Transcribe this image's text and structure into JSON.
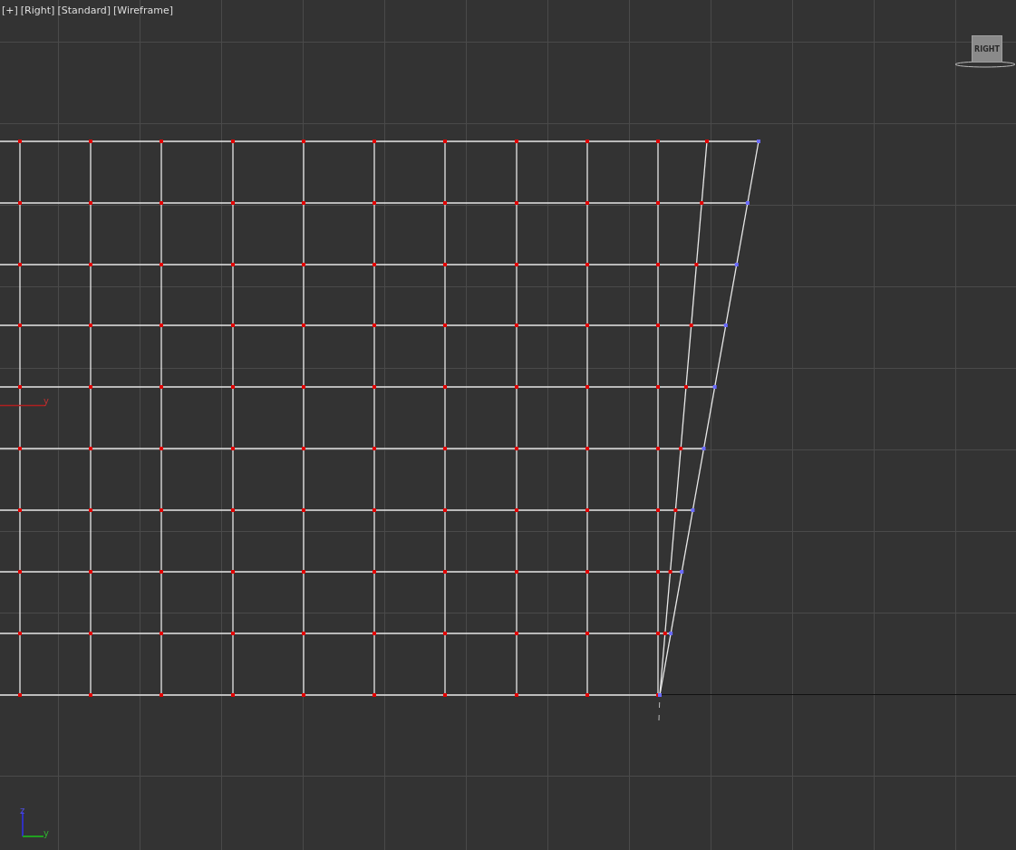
{
  "viewport": {
    "labels": [
      "[+]",
      "[Right]",
      "[Standard]",
      "[Wireframe]"
    ]
  },
  "view_cube": {
    "label": "RIGHT"
  },
  "grid_axis": {
    "label": "y"
  },
  "axis_gizmo": {
    "z_label": "z",
    "y_label": "y"
  }
}
